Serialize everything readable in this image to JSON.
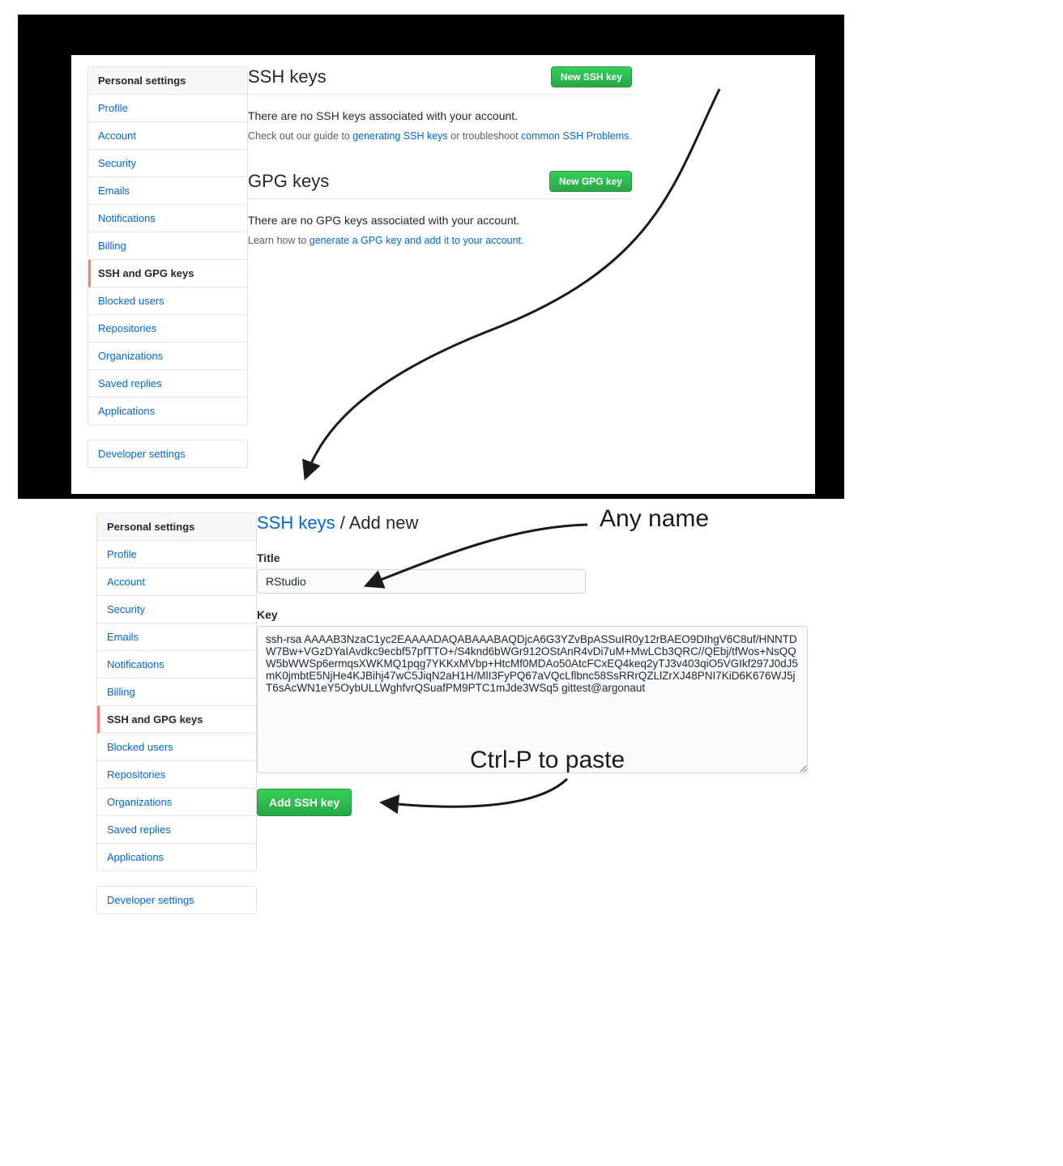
{
  "sidebar": {
    "header": "Personal settings",
    "items": [
      "Profile",
      "Account",
      "Security",
      "Emails",
      "Notifications",
      "Billing",
      "SSH and GPG keys",
      "Blocked users",
      "Repositories",
      "Organizations",
      "Saved replies",
      "Applications"
    ],
    "dev": "Developer settings"
  },
  "top": {
    "ssh_title": "SSH keys",
    "ssh_new_btn": "New SSH key",
    "ssh_empty": "There are no SSH keys associated with your account.",
    "ssh_hint_pre": "Check out our guide to ",
    "ssh_hint_link1": "generating SSH keys",
    "ssh_hint_mid": " or troubleshoot ",
    "ssh_hint_link2": "common SSH Problems",
    "ssh_hint_post": ".",
    "gpg_title": "GPG keys",
    "gpg_new_btn": "New GPG key",
    "gpg_empty": "There are no GPG keys associated with your account.",
    "gpg_hint_pre": "Learn how to ",
    "gpg_hint_link": "generate a GPG key and add it to your account",
    "gpg_hint_post": "."
  },
  "bottom": {
    "breadcrumb_link": "SSH keys",
    "breadcrumb_sep": " / ",
    "breadcrumb_tail": "Add new",
    "title_label": "Title",
    "title_value": "RStudio",
    "key_label": "Key",
    "key_value": "ssh-rsa AAAAB3NzaC1yc2EAAAADAQABAAABAQDjcA6G3YZvBpASSuIR0y12rBAEO9DIhgV6C8uf/HNNTDW7Bw+VGzDYaIAvdkc9ecbf57pfTTO+/S4knd6bWGr912OStAnR4vDi7uM+MwLCb3QRC//QEbj/tfWos+NsQQW5bWWSp6ermqsXWKMQ1pqg7YKKxMVbp+HtcMf0MDAo50AtcFCxEQ4keq2yTJ3v403qiO5VGIkf297J0dJ5mK0jmbtE5NjHe4KJBihj47wC5JiqN2aH1H/MlI3FyPQ67aVQcLflbnc58SsRRrQZLlZrXJ48PNI7KiD6K676WJ5jT6sAcWN1eY5OybULLWghfvrQSuafPM9PTC1mJde3WSq5 gittest@argonaut",
    "add_btn": "Add SSH key"
  },
  "anno": {
    "any_name": "Any name",
    "paste": "Ctrl-P to paste"
  }
}
